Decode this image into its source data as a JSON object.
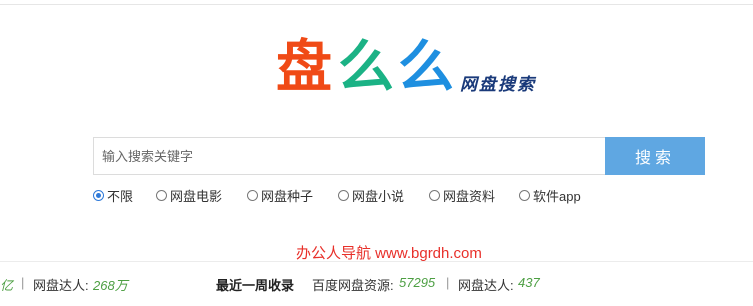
{
  "colors": {
    "logo_1": "#f04a16",
    "logo_2": "#1bb285",
    "logo_3": "#1e8fe0",
    "logo_subtitle": "#1a3a7a",
    "search_button": "#5fa7e2",
    "watermark": "#e8302a",
    "stat_number": "#4d9f43"
  },
  "logo": {
    "chars": [
      "盘",
      "么",
      "么"
    ],
    "subtitle": "网盘搜索"
  },
  "search": {
    "placeholder": "输入搜索关键字",
    "value": "",
    "button_label": "搜索"
  },
  "filters": {
    "selected": "不限",
    "options": [
      "不限",
      "网盘电影",
      "网盘种子",
      "网盘小说",
      "网盘资料",
      "软件app"
    ]
  },
  "watermark": "办公人导航 www.bgrdh.com",
  "stats": {
    "partial_unit": "亿",
    "sep": "|",
    "users_label_1": "网盘达人:",
    "users_value_1": "268万",
    "recent_label": "最近一周收录",
    "resources_label": "百度网盘资源:",
    "resources_value": "57295",
    "users_label_2": "网盘达人:",
    "users_value_2": "437"
  }
}
